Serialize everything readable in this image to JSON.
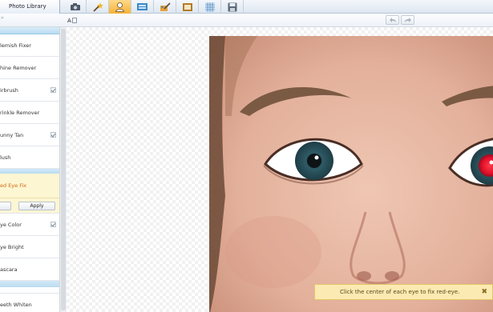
{
  "toolbar": {
    "library_label": "Photo Library",
    "tools": [
      {
        "icon": "camera-icon",
        "active": false
      },
      {
        "icon": "magic-wand-icon",
        "active": false
      },
      {
        "icon": "portrait-icon",
        "active": true
      },
      {
        "icon": "frames-icon",
        "active": false
      },
      {
        "icon": "brush-icon",
        "active": false
      },
      {
        "icon": "picture-frame-icon",
        "active": false
      },
      {
        "icon": "texture-icon",
        "active": false
      },
      {
        "icon": "save-icon",
        "active": false
      }
    ]
  },
  "subbar": {
    "font_label": "A",
    "left_mark": "»"
  },
  "sidebar": {
    "items_top": [
      {
        "label": "lemish Fixer",
        "checked": false
      },
      {
        "label": "hine Remover",
        "checked": false
      },
      {
        "label": "irbrush",
        "checked": true
      },
      {
        "label": "rinkle Remover",
        "checked": false
      },
      {
        "label": "unny Tan",
        "checked": true
      },
      {
        "label": "lush",
        "checked": false
      }
    ],
    "active_item": "ed Eye Fix",
    "apply_label": "Apply",
    "items_bottom": [
      {
        "label": "ye Color",
        "checked": true
      },
      {
        "label": "ye Bright",
        "checked": false
      },
      {
        "label": "ascara",
        "checked": false
      }
    ],
    "last_item": "eeth Whiten"
  },
  "hint": {
    "text": "Click the center of each eye to fix red-eye.",
    "close": "✖"
  },
  "colors": {
    "accent": "#f5b238",
    "active_text": "#d06a10",
    "hint_bg": "#fbeab2",
    "header_blue": "#b7dbf1"
  }
}
